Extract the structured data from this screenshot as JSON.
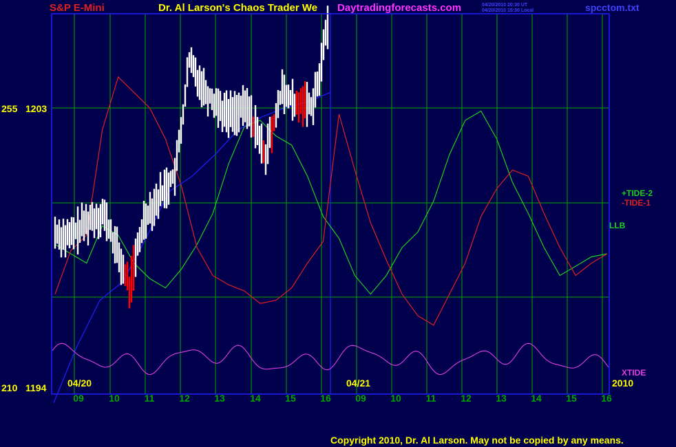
{
  "header": {
    "symbol": "S&P E-Mini",
    "title": "Dr. Al Larson's Chaos Trader We",
    "site": "Daytradingforecasts.com",
    "stamp_ut": "04/20/2010 20:30 UT",
    "stamp_local": "04/20/2010 15:30 Local",
    "file": "spcctom.txt"
  },
  "footer": {
    "copyright": "Copyright 2010, Dr. Al Larson. May not be copied by any means."
  },
  "colors": {
    "background": "#00004d",
    "grid": "#00a800",
    "frame": "#2020ff",
    "price": "#ffffff",
    "price_down": "#ff0000",
    "tide1": "#e02020",
    "tide2": "#20d020",
    "llb": "#2020ff",
    "xtide": "#e040e0",
    "yellow": "#ffff00",
    "cyan": "#00ffff",
    "magenta": "#ff33ff"
  },
  "chart_data": {
    "type": "line",
    "left_axis_labels": [
      "255",
      "210"
    ],
    "right_axis_labels": [
      "1203",
      "1194"
    ],
    "y_scale": {
      "top_label_value": 1203,
      "bottom_label_value": 1194
    },
    "date_labels": [
      "04/20",
      "04/21"
    ],
    "year_label": "2010",
    "x_tick_labels": [
      "09",
      "10",
      "11",
      "12",
      "13",
      "14",
      "15",
      "16",
      "09",
      "10",
      "11",
      "12",
      "13",
      "14",
      "15",
      "16"
    ],
    "series": [
      {
        "name": "+TIDE-2",
        "color": "#20d020",
        "values": [
          1198.6,
          1198.3,
          1198.0,
          1199.2,
          1198.9,
          1198.0,
          1197.5,
          1197.2,
          1197.8,
          1198.6,
          1199.6,
          1201.2,
          1202.4,
          1202.6,
          1202.1,
          1201.8,
          1200.8,
          1199.5,
          1198.8,
          1197.6,
          1197.0,
          1197.6,
          1198.5,
          1199.0,
          1200.0,
          1201.5,
          1202.6,
          1202.9,
          1202.0,
          1200.6,
          1199.6,
          1198.5,
          1197.6,
          1197.9,
          1198.2,
          1198.3
        ]
      },
      {
        "name": "-TIDE-1",
        "color": "#e02020",
        "values": [
          1197.0,
          1198.4,
          1198.9,
          1202.3,
          1204.0,
          1203.5,
          1203.0,
          1202.0,
          1200.5,
          1198.5,
          1197.6,
          1197.3,
          1197.1,
          1196.7,
          1196.8,
          1197.2,
          1198.0,
          1198.7,
          1202.8,
          1201.0,
          1199.3,
          1198.1,
          1197.0,
          1196.3,
          1196.0,
          1197.0,
          1198.0,
          1199.5,
          1200.4,
          1201.0,
          1200.8,
          1199.6,
          1198.5,
          1197.6,
          1198.0,
          1198.3
        ]
      },
      {
        "name": "LLB",
        "color": "#2020ff",
        "values": [
          1193.5,
          1195.3,
          1196.8,
          1197.4,
          1198.8,
          1200.3,
          1200.8,
          1201.5,
          1202.3,
          1202.7,
          1203.0,
          1203.2,
          1203.5
        ]
      },
      {
        "name": "XTIDE",
        "color": "#e040e0",
        "style": "oscillator",
        "min_label": "0",
        "max_label": "1"
      }
    ],
    "price_bars": "intraday 04/20 candles 09:00–16:00, ranging approx 1196.4–1206.6",
    "grid": true,
    "legend_placement": "right"
  }
}
